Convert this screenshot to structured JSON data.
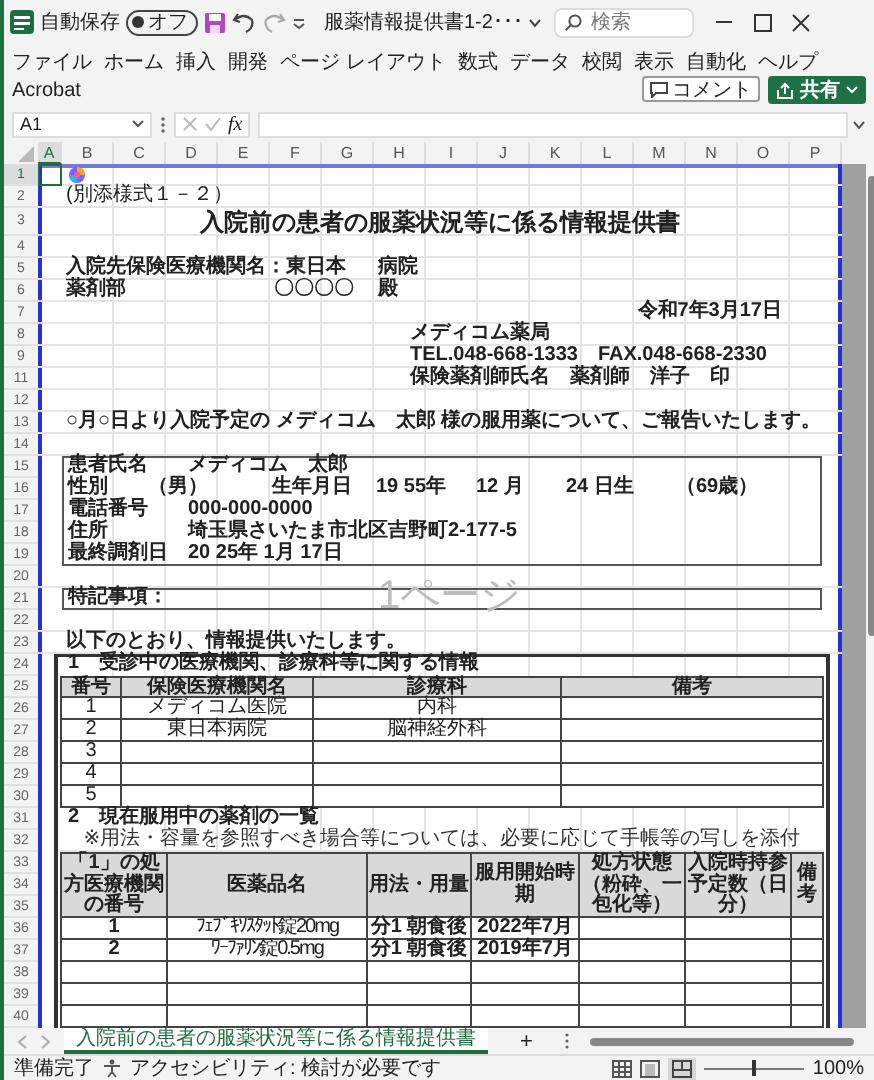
{
  "title_bar": {
    "autosave_label": "自動保存",
    "autosave": {
      "label": "オフ",
      "on": false
    },
    "file_name": "服薬情報提供書1-2･･･",
    "search_placeholder": "検索"
  },
  "menu_tabs": [
    "ファイル",
    "ホーム",
    "挿入",
    "開発",
    "ページ レイアウト",
    "数式",
    "データ",
    "校閲",
    "表示",
    "自動化",
    "ヘルプ",
    "Acrobat"
  ],
  "comment_button": "コメント",
  "share_button": "共有",
  "formula_bar": {
    "name_box": "A1",
    "fx": "fx"
  },
  "columns": [
    "A",
    "B",
    "C",
    "D",
    "E",
    "F",
    "G",
    "H",
    "I",
    "J",
    "K",
    "L",
    "M",
    "N",
    "O",
    "P"
  ],
  "row_numbers": [
    "1",
    "2",
    "3",
    "4",
    "5",
    "6",
    "7",
    "8",
    "9",
    "11",
    "12",
    "13",
    "14",
    "15",
    "16",
    "17",
    "18",
    "19",
    "20",
    "21",
    "22",
    "23",
    "24",
    "25",
    "26",
    "27",
    "28",
    "29",
    "30",
    "31",
    "32",
    "33",
    "34",
    "35",
    "36",
    "37",
    "38",
    "39",
    "40"
  ],
  "sheet": {
    "form_label": "(別添様式１－２）",
    "title": "入院前の患者の服薬状況等に係る情報提供書",
    "recipient_hospital": "入院先保険医療機関名：東日本",
    "hospital_suffix": "病院",
    "department": "薬剤部",
    "addressee": "〇〇〇〇",
    "honorific": "殿",
    "date": "令和7年3月17日",
    "pharmacy": "メディコム薬局",
    "contact": "TEL.048-668-1333　FAX.048-668-2330",
    "pharmacist": "保険薬剤師氏名　薬剤師　洋子　印",
    "intro": "○月○日より入院予定の メディコム　太郎 様の服用薬について、ご報告いたします。",
    "patient": {
      "name_label": "患者氏名",
      "name": "メディコム　太郎",
      "sex_label": "性別",
      "sex": "（男）",
      "birth_label": "生年月日",
      "birth_year": "19 55年",
      "birth_month": "12 月",
      "birth_day": "24 日生",
      "age": "（69歳）",
      "phone_label": "電話番号",
      "phone": "000-000-0000",
      "address_label": "住所",
      "address": "埼玉県さいたま市北区吉野町2-177-5",
      "last_label": "最終調剤日",
      "last_date": "20 25年 1月 17日"
    },
    "notes_label": "特記事項：",
    "page_label": "1ページ",
    "lead": "以下のとおり、情報提供いたします。",
    "section1": {
      "title": "1　受診中の医療機関、診療科等に関する情報",
      "columns": [
        "番号",
        "保険医療機関名",
        "診療科",
        "備考"
      ],
      "rows": [
        {
          "number": "1",
          "institution": "メディコム医院",
          "department": "内科"
        },
        {
          "number": "2",
          "institution": "東日本病院",
          "department": "脳神経外科"
        },
        {
          "number": "3"
        },
        {
          "number": "4"
        },
        {
          "number": "5"
        }
      ]
    },
    "section2": {
      "title": "2　現在服用中の薬剤の一覧",
      "note": "※用法・容量を参照すべき場合等については、必要に応じて手帳等の写しを添付",
      "columns": [
        "「1」の処方医療機関の番号",
        "医薬品名",
        "用法・用量",
        "服用開始時期",
        "処方状態（粉砕、一包化等）",
        "入院時持参予定数（日分）",
        "備考"
      ],
      "rows": [
        {
          "number": "1",
          "drug": "ﾌｪﾌﾞｷｿｽﾀｯﾄ錠20mg",
          "dosage": "分1 朝食後",
          "start": "2022年7月"
        },
        {
          "number": "2",
          "drug": "ﾜｰﾌｧﾘﾝ錠0.5mg",
          "dosage": "分1 朝食後",
          "start": "2019年7月"
        }
      ]
    }
  },
  "sheet_tab": {
    "label": "入院前の患者の服薬状況等に係る情報提供書",
    "selected": true
  },
  "add_sheet": "+",
  "status_bar": {
    "ready": "準備完了",
    "accessibility": "アクセシビリティ: 検討が必要です",
    "zoom_slider": {
      "level": 0.5
    },
    "zoom": "100%"
  }
}
